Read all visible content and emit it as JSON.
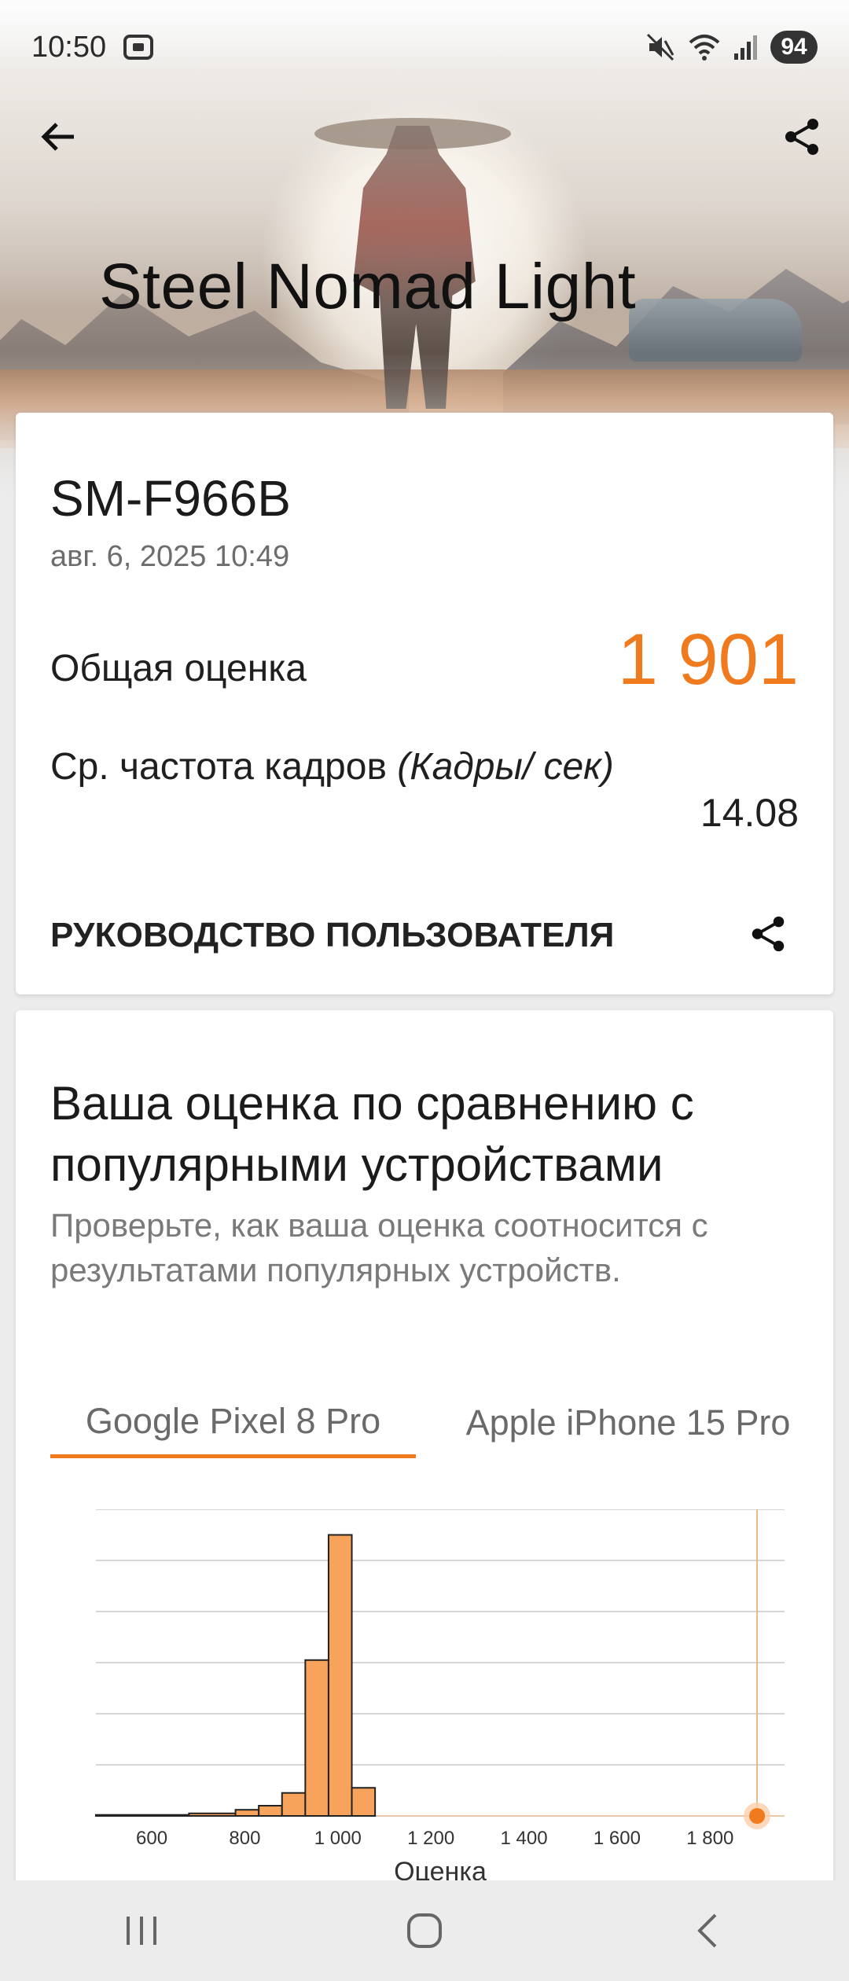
{
  "status_bar": {
    "time": "10:50",
    "battery": "94"
  },
  "hero": {
    "title": "Steel Nomad Light"
  },
  "result_card": {
    "device": "SM-F966B",
    "date": "авг. 6, 2025 10:49",
    "score_label": "Общая оценка",
    "score_value": "1 901",
    "fps_label_main": "Ср. частота кадров",
    "fps_label_unit": "(Кадры/ сек)",
    "fps_value": "14.08",
    "guide_label": "РУКОВОДСТВО ПОЛЬЗОВАТЕЛЯ"
  },
  "comparison_card": {
    "title": "Ваша оценка по сравнению с популярными устройствами",
    "subtitle": "Проверьте, как ваша оценка соотносится с результатами популярных устройств.",
    "tabs": [
      {
        "label": "Google Pixel 8 Pro",
        "active": true
      },
      {
        "label": "Apple iPhone 15 Pro",
        "active": false
      }
    ]
  },
  "colors": {
    "accent": "#f07a1e",
    "bar_fill": "#f8a35c",
    "bar_stroke": "#e8761e"
  },
  "chart_data": {
    "type": "bar",
    "xlabel": "Оценка",
    "ylabel": "",
    "xlim": [
      480,
      1960
    ],
    "ylim": [
      0,
      6
    ],
    "grid": true,
    "x_ticks": [
      600,
      800,
      1000,
      1200,
      1400,
      1600,
      1800
    ],
    "x_tick_labels": [
      "600",
      "800",
      "1 000",
      "1 200",
      "1 400",
      "1 600",
      "1 800"
    ],
    "bins": [
      {
        "x0": 480,
        "x1": 680,
        "value": 0.02
      },
      {
        "x0": 680,
        "x1": 780,
        "value": 0.05
      },
      {
        "x0": 780,
        "x1": 830,
        "value": 0.12
      },
      {
        "x0": 830,
        "x1": 880,
        "value": 0.2
      },
      {
        "x0": 880,
        "x1": 930,
        "value": 0.45
      },
      {
        "x0": 930,
        "x1": 980,
        "value": 3.05
      },
      {
        "x0": 980,
        "x1": 1030,
        "value": 5.5
      },
      {
        "x0": 1030,
        "x1": 1080,
        "value": 0.55
      }
    ],
    "marker": {
      "x": 1901,
      "label": "1 901"
    }
  }
}
